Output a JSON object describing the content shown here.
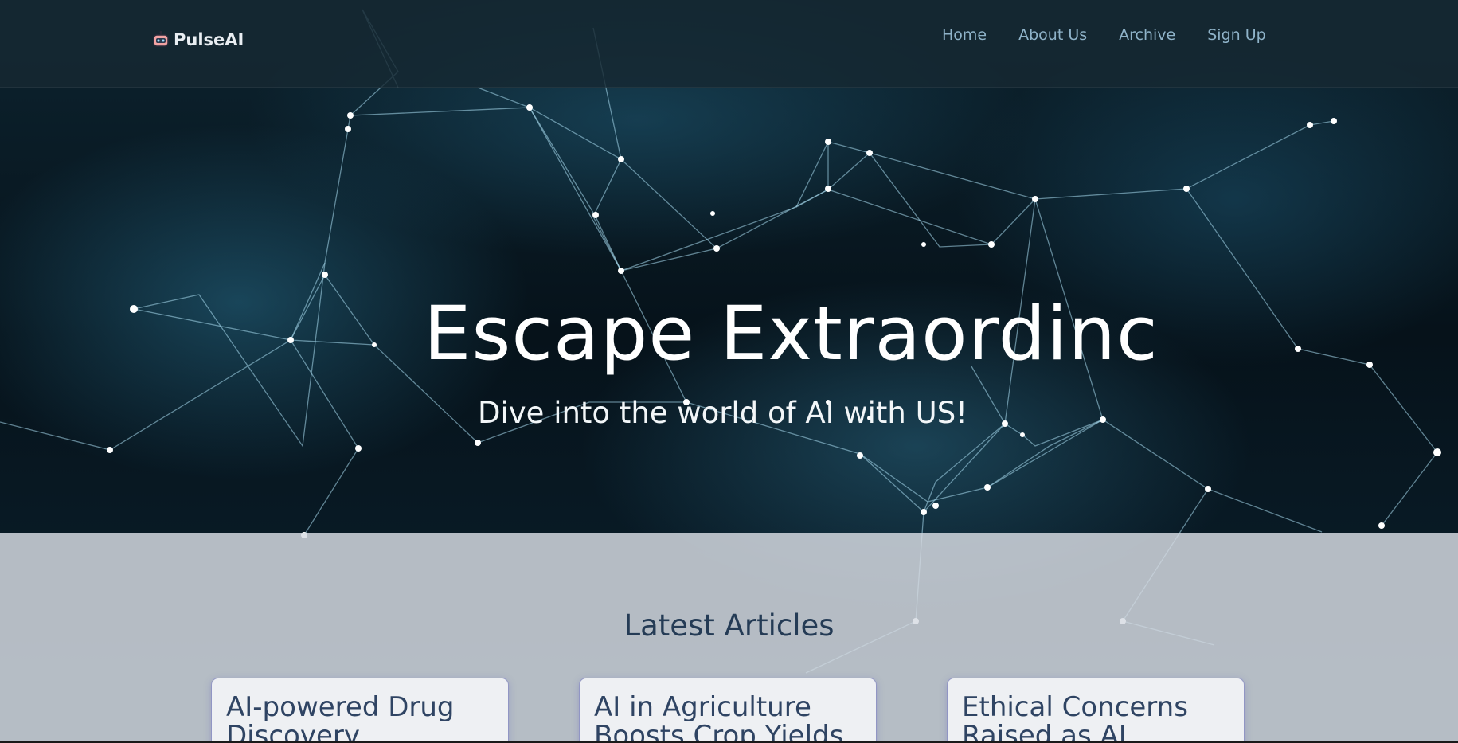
{
  "brand": {
    "name": "PulseAI",
    "icon": "robot-icon"
  },
  "nav": {
    "items": [
      "Home",
      "About Us",
      "Archive",
      "Sign Up"
    ]
  },
  "hero": {
    "title": "Escape Extraordinc",
    "subtitle": "Dive into the world of AI with US!"
  },
  "articles": {
    "heading": "Latest Articles",
    "cards": [
      {
        "title": "AI-powered Drug Discovery"
      },
      {
        "title": "AI in Agriculture Boosts Crop Yields"
      },
      {
        "title": "Ethical Concerns Raised as AI"
      }
    ]
  },
  "colors": {
    "header_bg": "#162832",
    "nav_link": "#8fb3c9",
    "heading": "#243b55",
    "card_title": "#2f4463"
  }
}
